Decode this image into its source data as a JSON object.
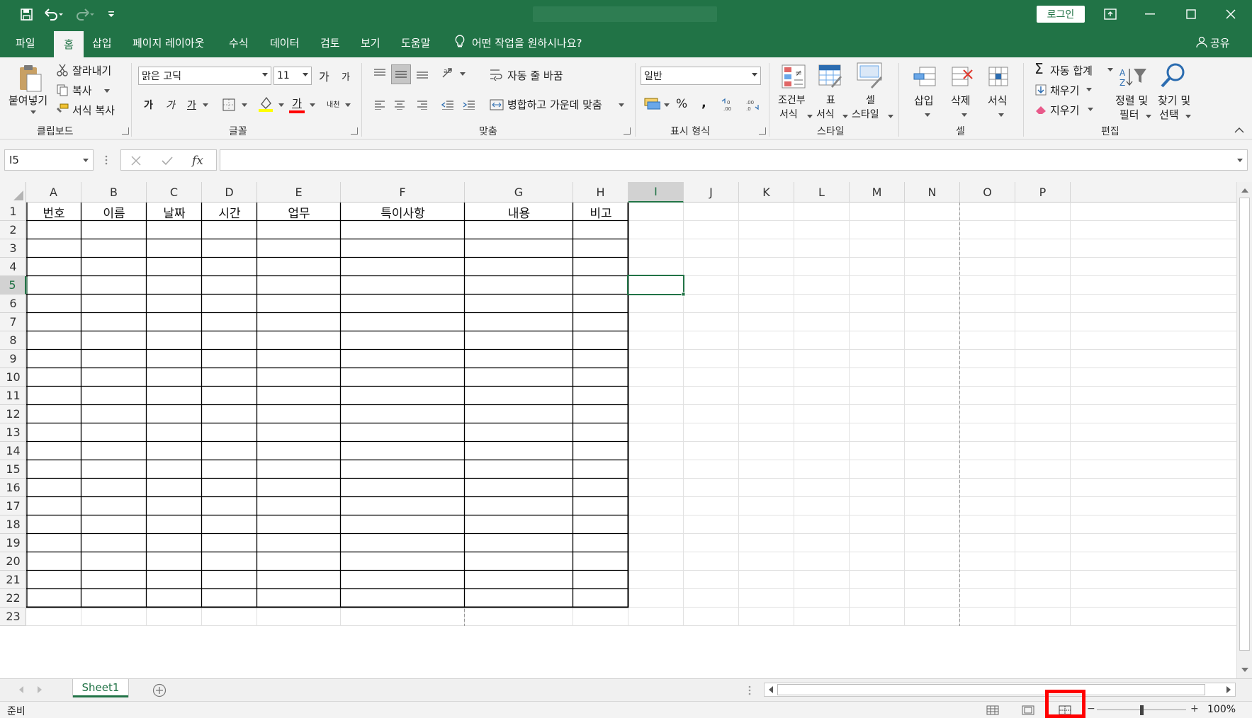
{
  "window": {
    "login_label": "로그인"
  },
  "menu": {
    "tabs": [
      "파일",
      "홈",
      "삽입",
      "페이지 레이아웃",
      "수식",
      "데이터",
      "검토",
      "보기",
      "도움말"
    ],
    "active_tab": "홈",
    "tell_me": "어떤 작업을 원하시나요?",
    "share": "공유"
  },
  "ribbon": {
    "clipboard": {
      "paste": "붙여넣기",
      "cut": "잘라내기",
      "copy": "복사",
      "format_painter": "서식 복사",
      "group": "클립보드"
    },
    "font": {
      "font_name": "맑은 고딕",
      "font_size": "11",
      "grow": "가",
      "shrink": "가",
      "bold": "가",
      "italic": "가",
      "underline": "가",
      "font_color": "가",
      "phonetic": "내천",
      "group": "글꼴",
      "font_color_hex": "#ff0000",
      "fill_color_hex": "#ffff00"
    },
    "alignment": {
      "wrap_text": "자동 줄 바꿈",
      "merge_center": "병합하고 가운데 맞춤",
      "group": "맞춤"
    },
    "number": {
      "format": "일반",
      "percent": "%",
      "comma": ",",
      "group": "표시 형식"
    },
    "styles": {
      "conditional_1": "조건부",
      "conditional_2": "서식",
      "table_1": "표",
      "table_2": "서식",
      "cell_1": "셀",
      "cell_2": "스타일",
      "group": "스타일"
    },
    "cells": {
      "insert": "삽입",
      "delete": "삭제",
      "format": "서식",
      "group": "셀"
    },
    "editing": {
      "autosum": "자동 합계",
      "fill": "채우기",
      "clear": "지우기",
      "sort_1": "정렬 및",
      "sort_2": "필터",
      "find_1": "찾기 및",
      "find_2": "선택",
      "group": "편집"
    }
  },
  "formula_bar": {
    "name_box": "I5",
    "fx": "fx",
    "value": ""
  },
  "sheet": {
    "columns": [
      "A",
      "B",
      "C",
      "D",
      "E",
      "F",
      "G",
      "H",
      "I",
      "J",
      "K",
      "L",
      "M",
      "N",
      "O",
      "P"
    ],
    "rows": [
      "1",
      "2",
      "3",
      "4",
      "5",
      "6",
      "7",
      "8",
      "9",
      "10",
      "11",
      "12",
      "13",
      "14",
      "15",
      "16",
      "17",
      "18",
      "19",
      "20",
      "21",
      "22",
      "23"
    ],
    "header_row": [
      "번호",
      "이름",
      "날짜",
      "시간",
      "업무",
      "특이사항",
      "내용",
      "비고"
    ],
    "selected_cell": "I5",
    "tab_name": "Sheet1",
    "accent": "#217346"
  },
  "status": {
    "ready": "준비",
    "zoom": "100%"
  }
}
